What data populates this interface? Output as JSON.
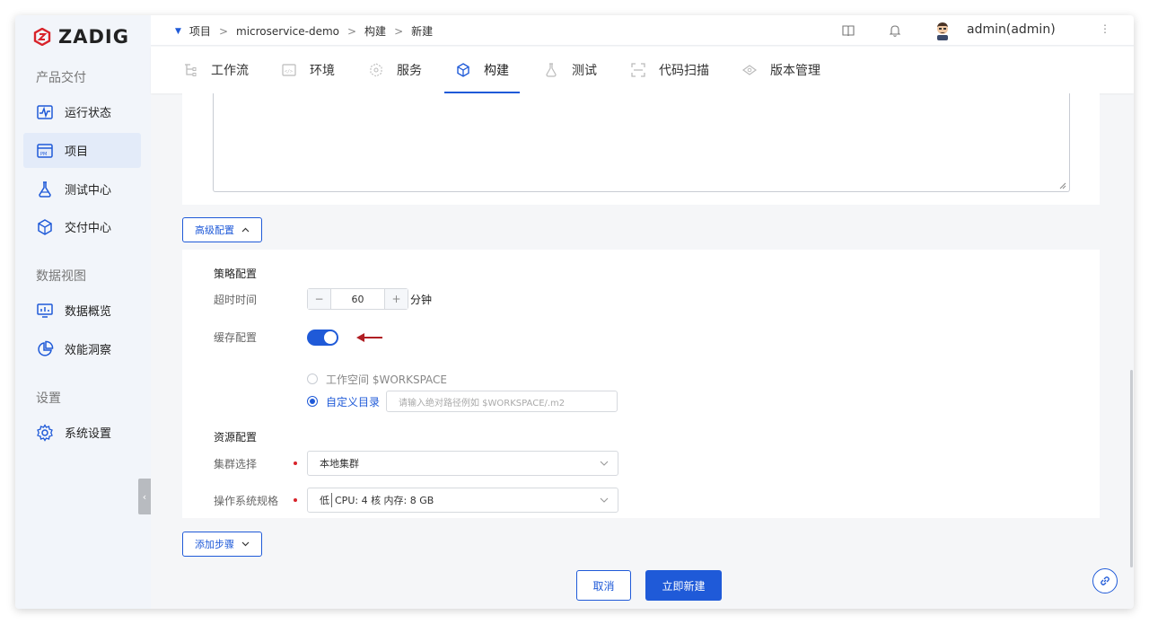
{
  "brand": {
    "name": "ZADIG",
    "accent": "#1f5ad8",
    "logo_color": "#d8232a"
  },
  "sidebar": {
    "sections": [
      {
        "title": "产品交付",
        "items": [
          {
            "label": "运行状态",
            "icon": "pulse-icon"
          },
          {
            "label": "项目",
            "icon": "pm-icon",
            "active": true
          },
          {
            "label": "测试中心",
            "icon": "flask-icon"
          },
          {
            "label": "交付中心",
            "icon": "package-icon"
          }
        ]
      },
      {
        "title": "数据视图",
        "items": [
          {
            "label": "数据概览",
            "icon": "monitor-chart-icon"
          },
          {
            "label": "效能洞察",
            "icon": "pie-chart-icon"
          }
        ]
      },
      {
        "title": "设置",
        "items": [
          {
            "label": "系统设置",
            "icon": "gear-icon"
          }
        ]
      }
    ],
    "collapse_glyph": "‹"
  },
  "breadcrumb": {
    "items": [
      "项目",
      "microservice-demo",
      "构建",
      "新建"
    ],
    "separator": ">"
  },
  "header": {
    "user": "admin(admin)",
    "icons": [
      "book-icon",
      "bell-icon",
      "more-icon"
    ]
  },
  "tabs": [
    {
      "label": "工作流",
      "icon": "workflow-icon"
    },
    {
      "label": "环境",
      "icon": "env-icon"
    },
    {
      "label": "服务",
      "icon": "service-icon"
    },
    {
      "label": "构建",
      "icon": "cube-icon",
      "active": true
    },
    {
      "label": "测试",
      "icon": "flask-icon"
    },
    {
      "label": "代码扫描",
      "icon": "scan-icon"
    },
    {
      "label": "版本管理",
      "icon": "version-icon"
    }
  ],
  "advanced": {
    "toggle_label": "高级配置",
    "strategy": {
      "title": "策略配置",
      "timeout_label": "超时时间",
      "timeout_value": "60",
      "timeout_unit": "分钟",
      "minus": "−",
      "plus": "+",
      "cache_label": "缓存配置",
      "cache_enabled": true,
      "cache_options": [
        {
          "label": "工作空间 $WORKSPACE",
          "selected": false
        },
        {
          "label": "自定义目录",
          "selected": true
        }
      ],
      "custom_dir_placeholder": "请输入绝对路径例如 $WORKSPACE/.m2"
    },
    "resource": {
      "title": "资源配置",
      "cluster_label": "集群选择",
      "cluster_value": "本地集群",
      "os_label": "操作系统规格",
      "os_level": "低",
      "os_spec": "CPU: 4 核 内存: 8 GB"
    }
  },
  "add_step_label": "添加步骤",
  "footer": {
    "cancel": "取消",
    "submit": "立即新建"
  }
}
